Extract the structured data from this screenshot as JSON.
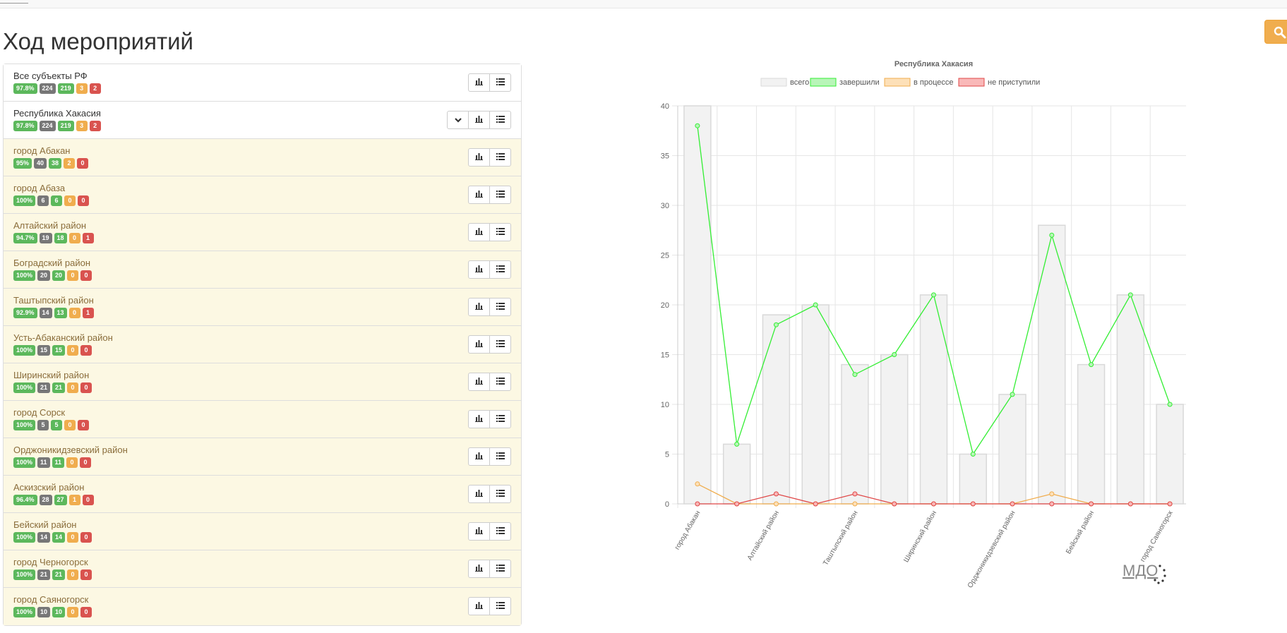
{
  "page": {
    "title": "Ход мероприятий"
  },
  "rows": [
    {
      "name": "Все субъекты РФ",
      "pct": "97.8%",
      "total": "224",
      "done": "219",
      "in_progress": "3",
      "not_started": "2",
      "child": false,
      "expand": false
    },
    {
      "name": "Республика Хакасия",
      "pct": "97.8%",
      "total": "224",
      "done": "219",
      "in_progress": "3",
      "not_started": "2",
      "child": false,
      "expand": true
    },
    {
      "name": "город Абакан",
      "pct": "95%",
      "total": "40",
      "done": "38",
      "in_progress": "2",
      "not_started": "0",
      "child": true,
      "expand": false
    },
    {
      "name": "город Абаза",
      "pct": "100%",
      "total": "6",
      "done": "6",
      "in_progress": "0",
      "not_started": "0",
      "child": true,
      "expand": false
    },
    {
      "name": "Алтайский район",
      "pct": "94.7%",
      "total": "19",
      "done": "18",
      "in_progress": "0",
      "not_started": "1",
      "child": true,
      "expand": false
    },
    {
      "name": "Боградский район",
      "pct": "100%",
      "total": "20",
      "done": "20",
      "in_progress": "0",
      "not_started": "0",
      "child": true,
      "expand": false
    },
    {
      "name": "Таштыпский район",
      "pct": "92.9%",
      "total": "14",
      "done": "13",
      "in_progress": "0",
      "not_started": "1",
      "child": true,
      "expand": false
    },
    {
      "name": "Усть-Абаканский район",
      "pct": "100%",
      "total": "15",
      "done": "15",
      "in_progress": "0",
      "not_started": "0",
      "child": true,
      "expand": false
    },
    {
      "name": "Ширинский район",
      "pct": "100%",
      "total": "21",
      "done": "21",
      "in_progress": "0",
      "not_started": "0",
      "child": true,
      "expand": false
    },
    {
      "name": "город Сорск",
      "pct": "100%",
      "total": "5",
      "done": "5",
      "in_progress": "0",
      "not_started": "0",
      "child": true,
      "expand": false
    },
    {
      "name": "Орджоникидзевский район",
      "pct": "100%",
      "total": "11",
      "done": "11",
      "in_progress": "0",
      "not_started": "0",
      "child": true,
      "expand": false
    },
    {
      "name": "Аскизский район",
      "pct": "96.4%",
      "total": "28",
      "done": "27",
      "in_progress": "1",
      "not_started": "0",
      "child": true,
      "expand": false
    },
    {
      "name": "Бейский район",
      "pct": "100%",
      "total": "14",
      "done": "14",
      "in_progress": "0",
      "not_started": "0",
      "child": true,
      "expand": false
    },
    {
      "name": "город Черногорск",
      "pct": "100%",
      "total": "21",
      "done": "21",
      "in_progress": "0",
      "not_started": "0",
      "child": true,
      "expand": false
    },
    {
      "name": "город Саяногорск",
      "pct": "100%",
      "total": "10",
      "done": "10",
      "in_progress": "0",
      "not_started": "0",
      "child": true,
      "expand": false
    }
  ],
  "icons": {
    "search": "search-icon",
    "expand": "chevron-down-icon",
    "chart": "bar-chart-icon",
    "list": "list-icon"
  },
  "colors": {
    "success": "#5cb85c",
    "total": "#777777",
    "warning": "#f0ad4e",
    "danger": "#d9534f",
    "child_row_bg": "#fcf8e3",
    "child_row_text": "#8a6d3b"
  },
  "watermark": "МДО",
  "chart_data": {
    "type": "bar",
    "title": "Республика Хакасия",
    "categories": [
      "город Абакан",
      "город Абаза",
      "Алтайский район",
      "Боградский район",
      "Таштыпский район",
      "Усть-Абаканский район",
      "Ширинский район",
      "город Сорск",
      "Орджоникидзевский район",
      "Аскизский район",
      "Бейский район",
      "город Черногорск",
      "город Саяногорск"
    ],
    "series": [
      {
        "name": "всего",
        "render": "bar",
        "color": "#d9d9d9",
        "values": [
          40,
          6,
          19,
          20,
          14,
          15,
          21,
          5,
          11,
          28,
          14,
          21,
          10
        ]
      },
      {
        "name": "завершили",
        "render": "line",
        "color": "#33ee33",
        "values": [
          38,
          6,
          18,
          20,
          13,
          15,
          21,
          5,
          11,
          27,
          14,
          21,
          10
        ]
      },
      {
        "name": "в процессе",
        "render": "line",
        "color": "#f0ad4e",
        "values": [
          2,
          0,
          0,
          0,
          0,
          0,
          0,
          0,
          0,
          1,
          0,
          0,
          0
        ]
      },
      {
        "name": "не приступили",
        "render": "line",
        "color": "#e04848",
        "values": [
          0,
          0,
          1,
          0,
          1,
          0,
          0,
          0,
          0,
          0,
          0,
          0,
          0
        ]
      }
    ],
    "ylim": [
      0,
      40
    ],
    "yticks": [
      0,
      5,
      10,
      15,
      20,
      25,
      30,
      35,
      40
    ],
    "x_tick_labels_shown": [
      "город Абакан",
      "Алтайский район",
      "Таштыпский район",
      "Ширинский район",
      "Орджоникидзевский район",
      "Бейский район",
      "город Саяногорск"
    ],
    "grid": true,
    "legend_position": "top"
  }
}
